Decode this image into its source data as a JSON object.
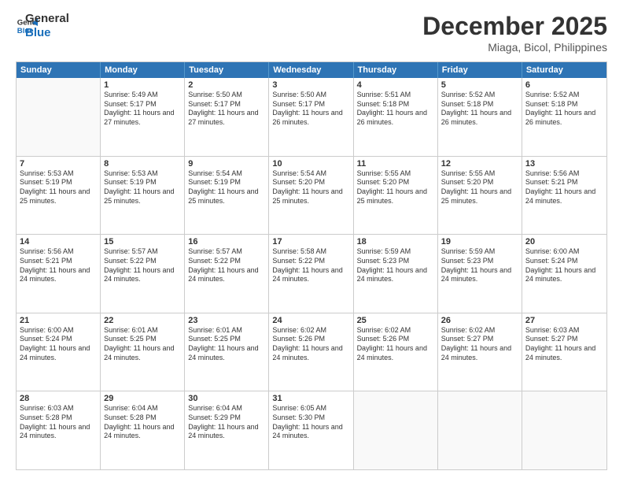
{
  "logo": {
    "line1": "General",
    "line2": "Blue"
  },
  "title": "December 2025",
  "location": "Miaga, Bicol, Philippines",
  "days_header": [
    "Sunday",
    "Monday",
    "Tuesday",
    "Wednesday",
    "Thursday",
    "Friday",
    "Saturday"
  ],
  "weeks": [
    [
      {
        "day": "",
        "sunrise": "",
        "sunset": "",
        "daylight": ""
      },
      {
        "day": "1",
        "sunrise": "Sunrise: 5:49 AM",
        "sunset": "Sunset: 5:17 PM",
        "daylight": "Daylight: 11 hours and 27 minutes."
      },
      {
        "day": "2",
        "sunrise": "Sunrise: 5:50 AM",
        "sunset": "Sunset: 5:17 PM",
        "daylight": "Daylight: 11 hours and 27 minutes."
      },
      {
        "day": "3",
        "sunrise": "Sunrise: 5:50 AM",
        "sunset": "Sunset: 5:17 PM",
        "daylight": "Daylight: 11 hours and 26 minutes."
      },
      {
        "day": "4",
        "sunrise": "Sunrise: 5:51 AM",
        "sunset": "Sunset: 5:18 PM",
        "daylight": "Daylight: 11 hours and 26 minutes."
      },
      {
        "day": "5",
        "sunrise": "Sunrise: 5:52 AM",
        "sunset": "Sunset: 5:18 PM",
        "daylight": "Daylight: 11 hours and 26 minutes."
      },
      {
        "day": "6",
        "sunrise": "Sunrise: 5:52 AM",
        "sunset": "Sunset: 5:18 PM",
        "daylight": "Daylight: 11 hours and 26 minutes."
      }
    ],
    [
      {
        "day": "7",
        "sunrise": "Sunrise: 5:53 AM",
        "sunset": "Sunset: 5:19 PM",
        "daylight": "Daylight: 11 hours and 25 minutes."
      },
      {
        "day": "8",
        "sunrise": "Sunrise: 5:53 AM",
        "sunset": "Sunset: 5:19 PM",
        "daylight": "Daylight: 11 hours and 25 minutes."
      },
      {
        "day": "9",
        "sunrise": "Sunrise: 5:54 AM",
        "sunset": "Sunset: 5:19 PM",
        "daylight": "Daylight: 11 hours and 25 minutes."
      },
      {
        "day": "10",
        "sunrise": "Sunrise: 5:54 AM",
        "sunset": "Sunset: 5:20 PM",
        "daylight": "Daylight: 11 hours and 25 minutes."
      },
      {
        "day": "11",
        "sunrise": "Sunrise: 5:55 AM",
        "sunset": "Sunset: 5:20 PM",
        "daylight": "Daylight: 11 hours and 25 minutes."
      },
      {
        "day": "12",
        "sunrise": "Sunrise: 5:55 AM",
        "sunset": "Sunset: 5:20 PM",
        "daylight": "Daylight: 11 hours and 25 minutes."
      },
      {
        "day": "13",
        "sunrise": "Sunrise: 5:56 AM",
        "sunset": "Sunset: 5:21 PM",
        "daylight": "Daylight: 11 hours and 24 minutes."
      }
    ],
    [
      {
        "day": "14",
        "sunrise": "Sunrise: 5:56 AM",
        "sunset": "Sunset: 5:21 PM",
        "daylight": "Daylight: 11 hours and 24 minutes."
      },
      {
        "day": "15",
        "sunrise": "Sunrise: 5:57 AM",
        "sunset": "Sunset: 5:22 PM",
        "daylight": "Daylight: 11 hours and 24 minutes."
      },
      {
        "day": "16",
        "sunrise": "Sunrise: 5:57 AM",
        "sunset": "Sunset: 5:22 PM",
        "daylight": "Daylight: 11 hours and 24 minutes."
      },
      {
        "day": "17",
        "sunrise": "Sunrise: 5:58 AM",
        "sunset": "Sunset: 5:22 PM",
        "daylight": "Daylight: 11 hours and 24 minutes."
      },
      {
        "day": "18",
        "sunrise": "Sunrise: 5:59 AM",
        "sunset": "Sunset: 5:23 PM",
        "daylight": "Daylight: 11 hours and 24 minutes."
      },
      {
        "day": "19",
        "sunrise": "Sunrise: 5:59 AM",
        "sunset": "Sunset: 5:23 PM",
        "daylight": "Daylight: 11 hours and 24 minutes."
      },
      {
        "day": "20",
        "sunrise": "Sunrise: 6:00 AM",
        "sunset": "Sunset: 5:24 PM",
        "daylight": "Daylight: 11 hours and 24 minutes."
      }
    ],
    [
      {
        "day": "21",
        "sunrise": "Sunrise: 6:00 AM",
        "sunset": "Sunset: 5:24 PM",
        "daylight": "Daylight: 11 hours and 24 minutes."
      },
      {
        "day": "22",
        "sunrise": "Sunrise: 6:01 AM",
        "sunset": "Sunset: 5:25 PM",
        "daylight": "Daylight: 11 hours and 24 minutes."
      },
      {
        "day": "23",
        "sunrise": "Sunrise: 6:01 AM",
        "sunset": "Sunset: 5:25 PM",
        "daylight": "Daylight: 11 hours and 24 minutes."
      },
      {
        "day": "24",
        "sunrise": "Sunrise: 6:02 AM",
        "sunset": "Sunset: 5:26 PM",
        "daylight": "Daylight: 11 hours and 24 minutes."
      },
      {
        "day": "25",
        "sunrise": "Sunrise: 6:02 AM",
        "sunset": "Sunset: 5:26 PM",
        "daylight": "Daylight: 11 hours and 24 minutes."
      },
      {
        "day": "26",
        "sunrise": "Sunrise: 6:02 AM",
        "sunset": "Sunset: 5:27 PM",
        "daylight": "Daylight: 11 hours and 24 minutes."
      },
      {
        "day": "27",
        "sunrise": "Sunrise: 6:03 AM",
        "sunset": "Sunset: 5:27 PM",
        "daylight": "Daylight: 11 hours and 24 minutes."
      }
    ],
    [
      {
        "day": "28",
        "sunrise": "Sunrise: 6:03 AM",
        "sunset": "Sunset: 5:28 PM",
        "daylight": "Daylight: 11 hours and 24 minutes."
      },
      {
        "day": "29",
        "sunrise": "Sunrise: 6:04 AM",
        "sunset": "Sunset: 5:28 PM",
        "daylight": "Daylight: 11 hours and 24 minutes."
      },
      {
        "day": "30",
        "sunrise": "Sunrise: 6:04 AM",
        "sunset": "Sunset: 5:29 PM",
        "daylight": "Daylight: 11 hours and 24 minutes."
      },
      {
        "day": "31",
        "sunrise": "Sunrise: 6:05 AM",
        "sunset": "Sunset: 5:30 PM",
        "daylight": "Daylight: 11 hours and 24 minutes."
      },
      {
        "day": "",
        "sunrise": "",
        "sunset": "",
        "daylight": ""
      },
      {
        "day": "",
        "sunrise": "",
        "sunset": "",
        "daylight": ""
      },
      {
        "day": "",
        "sunrise": "",
        "sunset": "",
        "daylight": ""
      }
    ]
  ]
}
